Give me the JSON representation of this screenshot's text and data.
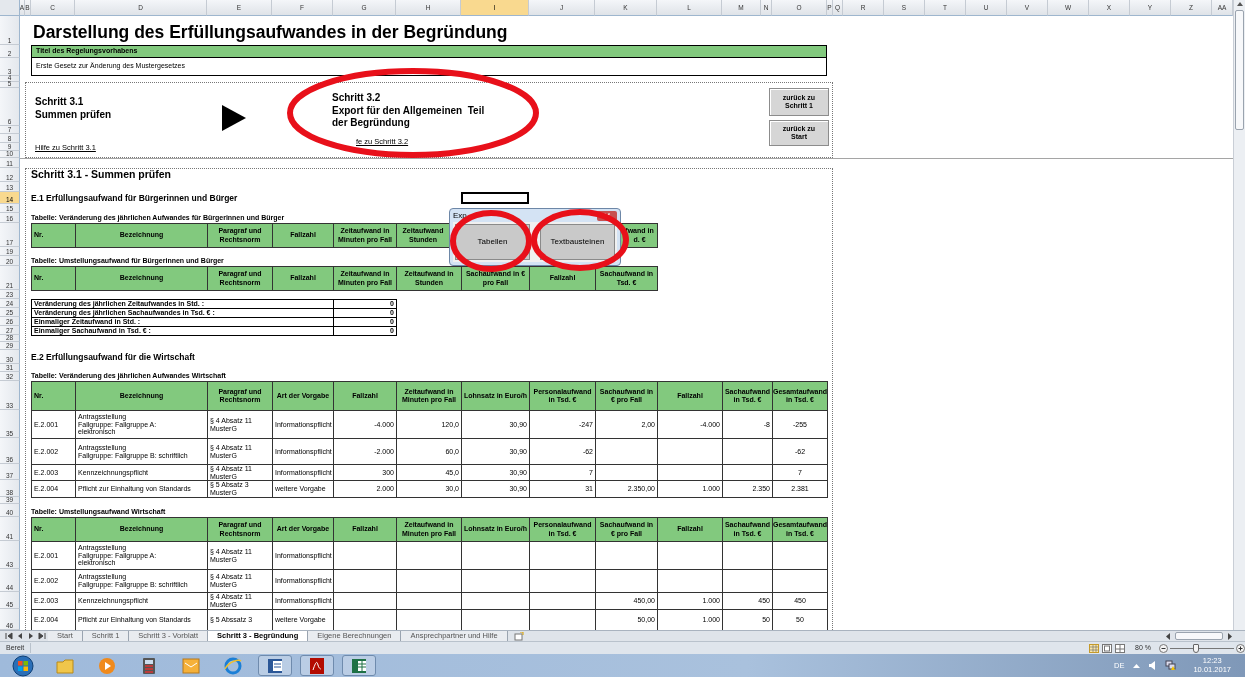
{
  "column_headers": [
    {
      "label": "A",
      "selected": false
    },
    {
      "label": "B",
      "selected": false
    },
    {
      "label": "C",
      "selected": false
    },
    {
      "label": "D",
      "selected": false
    },
    {
      "label": "E",
      "selected": false
    },
    {
      "label": "F",
      "selected": false
    },
    {
      "label": "G",
      "selected": false
    },
    {
      "label": "H",
      "selected": false
    },
    {
      "label": "I",
      "selected": true
    },
    {
      "label": "J",
      "selected": false
    },
    {
      "label": "K",
      "selected": false
    },
    {
      "label": "L",
      "selected": false
    },
    {
      "label": "M",
      "selected": false
    },
    {
      "label": "N",
      "selected": false
    },
    {
      "label": "O",
      "selected": false
    },
    {
      "label": "P",
      "selected": false
    },
    {
      "label": "Q",
      "selected": false
    },
    {
      "label": "R",
      "selected": false
    },
    {
      "label": "S",
      "selected": false
    },
    {
      "label": "T",
      "selected": false
    },
    {
      "label": "U",
      "selected": false
    },
    {
      "label": "V",
      "selected": false
    },
    {
      "label": "W",
      "selected": false
    },
    {
      "label": "X",
      "selected": false
    },
    {
      "label": "Y",
      "selected": false
    },
    {
      "label": "Z",
      "selected": false
    },
    {
      "label": "AA",
      "selected": false
    }
  ],
  "row_headers": [
    {
      "label": "1",
      "selected": false
    },
    {
      "label": "2",
      "selected": false
    },
    {
      "label": "3",
      "selected": false
    },
    {
      "label": "4",
      "selected": false
    },
    {
      "label": "5",
      "selected": false
    },
    {
      "label": "6",
      "selected": false
    },
    {
      "label": "7",
      "selected": false
    },
    {
      "label": "8",
      "selected": false
    },
    {
      "label": "9",
      "selected": false
    },
    {
      "label": "10",
      "selected": false
    },
    {
      "label": "11",
      "selected": false
    },
    {
      "label": "12",
      "selected": false
    },
    {
      "label": "13",
      "selected": false
    },
    {
      "label": "14",
      "selected": true
    },
    {
      "label": "15",
      "selected": false
    },
    {
      "label": "16",
      "selected": false
    },
    {
      "label": "17",
      "selected": false
    },
    {
      "label": "19",
      "selected": false
    },
    {
      "label": "20",
      "selected": false
    },
    {
      "label": "21",
      "selected": false
    },
    {
      "label": "23",
      "selected": false
    },
    {
      "label": "24",
      "selected": false
    },
    {
      "label": "25",
      "selected": false
    },
    {
      "label": "26",
      "selected": false
    },
    {
      "label": "27",
      "selected": false
    },
    {
      "label": "28",
      "selected": false
    },
    {
      "label": "29",
      "selected": false
    },
    {
      "label": "30",
      "selected": false
    },
    {
      "label": "31",
      "selected": false
    },
    {
      "label": "32",
      "selected": false
    },
    {
      "label": "33",
      "selected": false
    },
    {
      "label": "35",
      "selected": false
    },
    {
      "label": "36",
      "selected": false
    },
    {
      "label": "37",
      "selected": false
    },
    {
      "label": "38",
      "selected": false
    },
    {
      "label": "39",
      "selected": false
    },
    {
      "label": "40",
      "selected": false
    },
    {
      "label": "41",
      "selected": false
    },
    {
      "label": "43",
      "selected": false
    },
    {
      "label": "44",
      "selected": false
    },
    {
      "label": "45",
      "selected": false
    },
    {
      "label": "46",
      "selected": false
    }
  ],
  "title": "Darstellung des Erfüllungsaufwandes in der Begründung",
  "project": {
    "label": "Titel des Regelungsvorhabens",
    "value": "Erste Gesetz zur Änderung des Mustergesetzes"
  },
  "steps": [
    {
      "title": "Schritt 3.1",
      "subtitle": "Summen prüfen",
      "help_link": "Hilfe zu Schritt 3.1"
    },
    {
      "title": "Schritt 3.2",
      "subtitle": "Export für den Allgemeinen  Teil\nder Begründung",
      "help_link": "fe zu Schritt 3.2"
    }
  ],
  "nav_buttons": [
    "zurück zu Schritt 1",
    "zurück zu Start"
  ],
  "section_title": "Schritt 3.1 - Summen prüfen",
  "e1": {
    "heading": "E.1 Erfüllungsaufwand für Bürgerinnen und Bürger",
    "table_1": {
      "caption": "Tabelle: Veränderung des jährlichen Aufwandes für Bürgerinnen und Bürger",
      "columns": [
        "Nr.",
        "Bezeichnung",
        "Paragraf und Rechtsnorm",
        "Fallzahl",
        "Zeitaufwand in Minuten pro Fall",
        "Zeitaufwand Stunden"
      ],
      "column_9": "fwand in d. €"
    },
    "table_2": {
      "caption": "Tabelle: Umstellungsaufwand für Bürgerinnen und Bürger",
      "columns": [
        "Nr.",
        "Bezeichnung",
        "Paragraf und Rechtsnorm",
        "Fallzahl",
        "Zeitaufwand in Minuten pro Fall",
        "Zeitaufwand in Stunden",
        "Sachaufwand in € pro Fall",
        "Fallzahl",
        "Sachaufwand in Tsd. €"
      ]
    },
    "summary": [
      {
        "label": "Veränderung des jährlichen Zeitaufwandes in Std. :",
        "value": "0"
      },
      {
        "label": "Veränderung des jährlichen Sachaufwandes in Tsd. € :",
        "value": "0"
      },
      {
        "label": "Einmaliger Zeitaufwand in Std. :",
        "value": "0"
      },
      {
        "label": "Einmaliger Sachaufwand in Tsd. € :",
        "value": "0"
      }
    ]
  },
  "e2": {
    "heading": "E.2 Erfüllungsaufwand für die Wirtschaft",
    "tables": [
      {
        "caption": "Tabelle: Veränderung des jährlichen Aufwandes Wirtschaft",
        "columns": [
          "Nr.",
          "Bezeichnung",
          "Paragraf und Rechtsnorm",
          "Art der Vorgabe",
          "Fallzahl",
          "Zeitaufwand in Minuten pro Fall",
          "Lohnsatz in Euro/h",
          "Personalaufwand in Tsd. €",
          "Sachaufwand in € pro Fall",
          "Fallzahl",
          "Sachaufwand in Tsd. €",
          "Gesamtaufwand in Tsd. €"
        ],
        "rows": [
          [
            "E.2.001",
            "Antragsstellung\nFallgruppe: Fallgruppe A:\nelektronisch",
            "§ 4 Absatz 11\nMusterG",
            "Informationspflicht",
            "-4.000",
            "120,0",
            "30,90",
            "-247",
            "2,00",
            "-4.000",
            "-8",
            "-255"
          ],
          [
            "E.2.002",
            "Antragsstellung\nFallgruppe: Fallgruppe B: schriftlich",
            "§ 4 Absatz 11\nMusterG",
            "Informationspflicht",
            "-2.000",
            "60,0",
            "30,90",
            "-62",
            null,
            null,
            null,
            "-62"
          ],
          [
            "E.2.003",
            "Kennzeichnungspflicht",
            "§ 4 Absatz 11\nMusterG",
            "Informationspflicht",
            "300",
            "45,0",
            "30,90",
            "7",
            null,
            null,
            null,
            "7"
          ],
          [
            "E.2.004",
            "Pflicht zur Einhaltung von Standards",
            "§ 5 Absatz 3\nMusterG",
            "weitere Vorgabe",
            "2.000",
            "30,0",
            "30,90",
            "31",
            "2.350,00",
            "1.000",
            "2.350",
            "2.381"
          ]
        ]
      },
      {
        "caption": "Tabelle: Umstellungsaufwand Wirtschaft",
        "columns": [
          "Nr.",
          "Bezeichnung",
          "Paragraf und Rechtsnorm",
          "Art der Vorgabe",
          "Fallzahl",
          "Zeitaufwand in Minuten pro Fall",
          "Lohnsatz in Euro/h",
          "Personalaufwand in Tsd. €",
          "Sachaufwand in € pro Fall",
          "Fallzahl",
          "Sachaufwand in Tsd. €",
          "Gesamtaufwand in Tsd. €"
        ],
        "rows": [
          [
            "E.2.001",
            "Antragsstellung\nFallgruppe: Fallgruppe A:\nelektronisch",
            "§ 4 Absatz 11\nMusterG",
            "Informationspflicht",
            null,
            null,
            null,
            null,
            null,
            null,
            null,
            null
          ],
          [
            "E.2.002",
            "Antragsstellung\nFallgruppe: Fallgruppe B: schriftlich",
            "§ 4 Absatz 11\nMusterG",
            "Informationspflicht",
            null,
            null,
            null,
            null,
            null,
            null,
            null,
            null
          ],
          [
            "E.2.003",
            "Kennzeichnungspflicht",
            "§ 4 Absatz 11\nMusterG",
            "Informationspflicht",
            null,
            null,
            null,
            null,
            "450,00",
            "1.000",
            "450",
            "450"
          ],
          [
            "E.2.004",
            "Pflicht zur Einhaltung von Standards",
            "§ 5 Abssatz 3",
            "weitere Vorgabe",
            null,
            null,
            null,
            null,
            "50,00",
            "1.000",
            "50",
            "50"
          ]
        ]
      }
    ]
  },
  "dialog": {
    "title": "Exp",
    "buttons": [
      "Tabellen",
      "Textbausteinen"
    ]
  },
  "sheet_tabs": [
    {
      "label": "Start",
      "selected": false
    },
    {
      "label": "Schritt 1",
      "selected": false
    },
    {
      "label": "Schritt 3 - Vorblatt",
      "selected": false
    },
    {
      "label": "Schritt 3 - Begründung",
      "selected": true
    },
    {
      "label": "Eigene Berechnungen",
      "selected": false
    },
    {
      "label": "Ansprechpartner und Hilfe",
      "selected": false
    }
  ],
  "status_bar": {
    "text": "Bereit",
    "zoom": {
      "label": "80 %",
      "level": 0.4
    }
  },
  "taskbar": {
    "language": "DE",
    "time": "12:23",
    "date": "10.01.2017"
  }
}
